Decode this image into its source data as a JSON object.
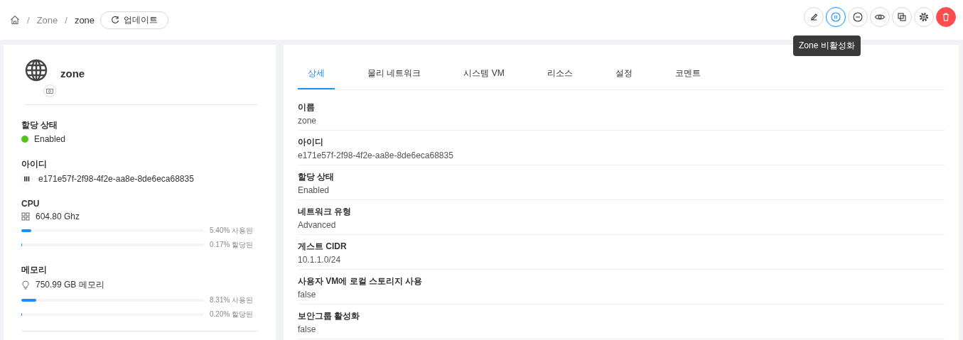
{
  "breadcrumb": {
    "items": [
      {
        "separator": "/",
        "label": "Zone"
      },
      {
        "separator": "/",
        "label": "zone"
      }
    ],
    "refresh_button": "업데이트"
  },
  "actions": [
    {
      "kind": "edit",
      "selected": false
    },
    {
      "kind": "pause",
      "selected": true
    },
    {
      "kind": "minus",
      "selected": false
    },
    {
      "kind": "eye",
      "selected": false
    },
    {
      "kind": "copy",
      "selected": false
    },
    {
      "kind": "settings",
      "selected": false
    },
    {
      "kind": "delete",
      "selected": false
    }
  ],
  "tooltip": "Zone 비활성화",
  "summary": {
    "name": "zone",
    "state": {
      "label": "할당 상태",
      "value": "Enabled",
      "color": "#52c41a"
    },
    "id": {
      "label": "아이디",
      "value": "e171e57f-2f98-4f2e-aa8e-8de6eca68835"
    },
    "resources": [
      {
        "label": "CPU",
        "kind": "cpu",
        "value": "604.80 Ghz",
        "bars": [
          {
            "level": 0.054,
            "reading": "5.40% 사용된"
          },
          {
            "level": 0.0017,
            "reading": "0.17% 할당된"
          }
        ]
      },
      {
        "label": "메모리",
        "kind": "memory",
        "value": "750.99 GB 메모리",
        "bars": [
          {
            "level": 0.0831,
            "reading": "8.31% 사용된"
          },
          {
            "level": 0.002,
            "reading": "0.20% 할당된"
          }
        ]
      }
    ]
  },
  "tabs": [
    {
      "label": "상세",
      "selected": true
    },
    {
      "label": "물리 네트워크",
      "selected": false
    },
    {
      "label": "시스템 VM",
      "selected": false
    },
    {
      "label": "리소스",
      "selected": false
    },
    {
      "label": "설정",
      "selected": false
    },
    {
      "label": "코멘트",
      "selected": false
    }
  ],
  "details": [
    {
      "label": "이름",
      "value": "zone"
    },
    {
      "label": "아이디",
      "value": "e171e57f-2f98-4f2e-aa8e-8de6eca68835"
    },
    {
      "label": "할당 상태",
      "value": "Enabled"
    },
    {
      "label": "네트워크 유형",
      "value": "Advanced"
    },
    {
      "label": "게스트 CIDR",
      "value": "10.1.1.0/24"
    },
    {
      "label": "사용자 VM에 로컬 스토리지 사용",
      "value": "false"
    },
    {
      "label": "보안그룹 활성화",
      "value": "false"
    }
  ]
}
